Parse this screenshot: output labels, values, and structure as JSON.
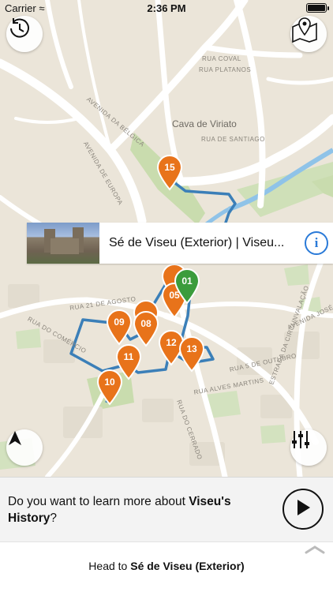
{
  "status": {
    "carrier": "Carrier",
    "time": "2:36 PM",
    "battery_level": 1.0
  },
  "map": {
    "streets": [
      "RUA COVAL",
      "RUA PLATANOS",
      "AVENIDA DA BÉLGICA",
      "AVENIDA DE EUROPA",
      "RUA 21 DE AGOSTO",
      "RUA 5 DE OUTUBRO",
      "RUA ALVES MARTINS",
      "AVENIDA JOSÉ RELVAS",
      "ESTRADA DA CIRCUNVALAÇÃO",
      "RUA DO COMÉRCIO",
      "RUA DE SANTIAGO",
      "RUA DO CERRADO"
    ],
    "place_label": "Cava de Viriato",
    "pins": [
      {
        "label": "15",
        "color": "#e8731a"
      },
      {
        "label": "01",
        "color": "#3b9c3c"
      },
      {
        "label": "05",
        "color": "#e8731a"
      },
      {
        "label": "09",
        "color": "#e8731a"
      },
      {
        "label": "08",
        "color": "#e8731a"
      },
      {
        "label": "12",
        "color": "#e8731a"
      },
      {
        "label": "13",
        "color": "#e8731a"
      },
      {
        "label": "11",
        "color": "#e8731a"
      },
      {
        "label": "10",
        "color": "#e8731a"
      }
    ],
    "route_color": "#3b7fb8"
  },
  "buttons": {
    "history_icon": "clock-history-icon",
    "map_pins_icon": "map-pins-icon",
    "locate_icon": "navigation-arrow-icon",
    "filter_icon": "sliders-icon"
  },
  "poi": {
    "title": "Sé de Viseu (Exterior) | Viseu..."
  },
  "prompt": {
    "text_before": "Do you want to learn more about ",
    "bold": "Viseu's History",
    "text_after": "?"
  },
  "bottom": {
    "prefix": "Head to ",
    "destination": "Sé de Viseu (Exterior)"
  }
}
